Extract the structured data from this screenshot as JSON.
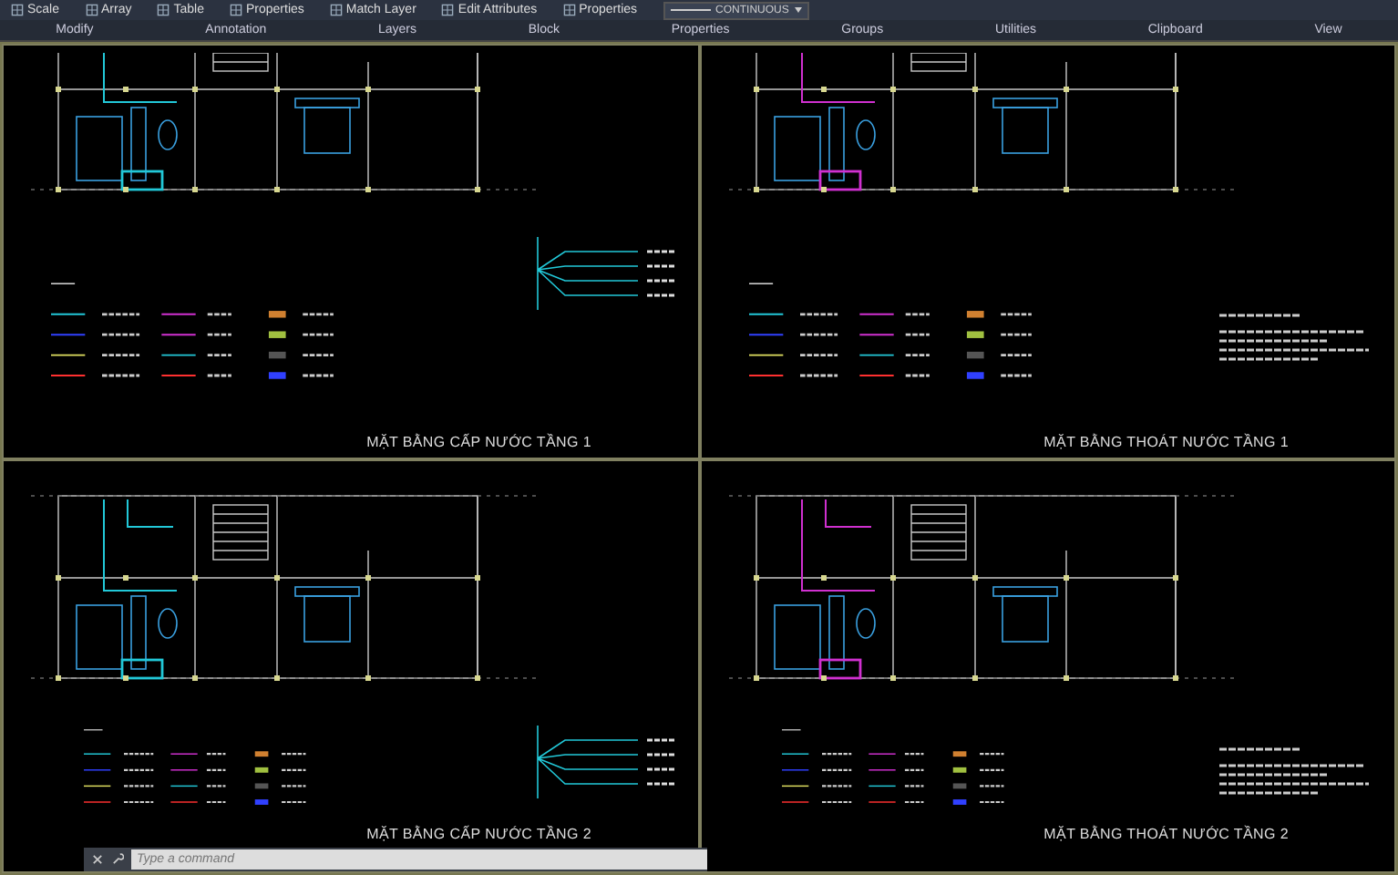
{
  "ribbon": {
    "tools": [
      {
        "label": "Scale",
        "kind": "tool"
      },
      {
        "label": "Array",
        "kind": "tool"
      },
      {
        "label": "Table",
        "kind": "tool"
      },
      {
        "label": "Properties",
        "kind": "tool"
      },
      {
        "label": "Match Layer",
        "kind": "tool"
      },
      {
        "label": "Edit Attributes",
        "kind": "tool"
      },
      {
        "label": "Properties",
        "kind": "tool"
      },
      {
        "label": "CONTINUOUS",
        "kind": "dropdown"
      }
    ],
    "panels": [
      "Modify",
      "Annotation",
      "Layers",
      "Block",
      "Properties",
      "Groups",
      "Utilities",
      "Clipboard",
      "View"
    ]
  },
  "sheets": [
    {
      "title": "MẶT BẰNG CẤP NƯỚC TẦNG 1",
      "kind": "supply"
    },
    {
      "title": "MẶT BẰNG THOÁT NƯỚC TẦNG 1",
      "kind": "drain"
    },
    {
      "title": "MẶT BẰNG CẤP NƯỚC TẦNG 2",
      "kind": "supply"
    },
    {
      "title": "MẶT BẰNG THOÁT NƯỚC TẦNG 2",
      "kind": "drain"
    }
  ],
  "command_line": {
    "placeholder": "Type a command"
  }
}
